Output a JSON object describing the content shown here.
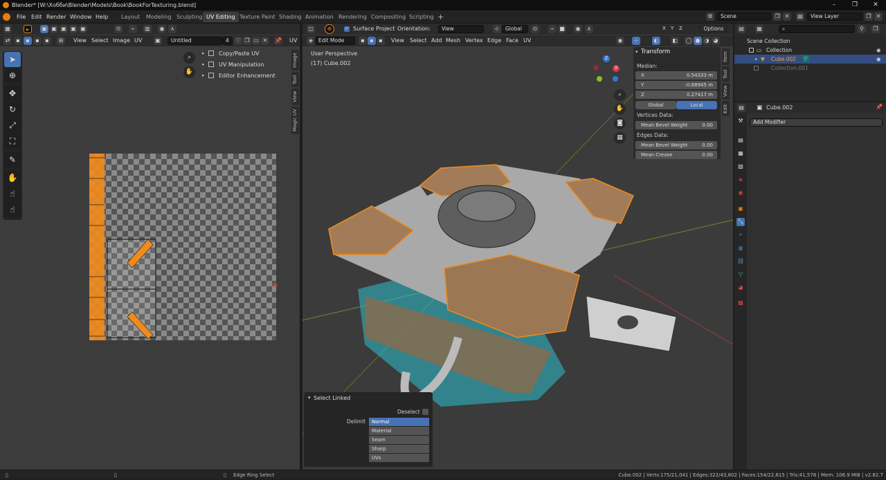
{
  "window": {
    "title": "Blender* [W:\\Хобби\\Blender\\Models\\Book\\BookForTexturing.blend]"
  },
  "menu": [
    "File",
    "Edit",
    "Render",
    "Window",
    "Help"
  ],
  "workspaces": [
    "Layout",
    "Modeling",
    "Sculpting",
    "UV Editing",
    "Texture Paint",
    "Shading",
    "Animation",
    "Rendering",
    "Compositing",
    "Scripting"
  ],
  "active_workspace": "UV Editing",
  "scene": {
    "label": "Scene",
    "view_layer": "View Layer"
  },
  "uv_editor": {
    "menus": [
      "View",
      "Select",
      "Image",
      "UV"
    ],
    "image_name": "Untitled",
    "image_users": "4",
    "right_label": "UV",
    "addon_panels": [
      "Copy/Paste UV",
      "UV Manipulation",
      "Editor Enhancement"
    ],
    "side_tabs": [
      "Image",
      "Tool",
      "View",
      "Magic UV"
    ]
  },
  "viewport": {
    "surface_project_label": "Surface Project",
    "orientation_label": "Orientation:",
    "orientation_value": "View",
    "mode": "Edit Mode",
    "menus": [
      "View",
      "Select",
      "Add",
      "Mesh",
      "Vertex",
      "Edge",
      "Face",
      "UV"
    ],
    "transform_space": "Global",
    "options_label": "Options",
    "overlay_line1": "User Perspective",
    "overlay_line2": "(17) Cube.002",
    "side_tabs": [
      "Item",
      "Tool",
      "View",
      "Edit"
    ],
    "gizmo_labels": [
      "X",
      "Y",
      "Z"
    ]
  },
  "transform_panel": {
    "title": "Transform",
    "median_label": "Median:",
    "coords": [
      {
        "axis": "X",
        "value": "0.54333 m"
      },
      {
        "axis": "Y",
        "value": "-0.68945 m"
      },
      {
        "axis": "Z",
        "value": "0.27417 m"
      }
    ],
    "space_buttons": [
      "Global",
      "Local"
    ],
    "vertices_label": "Vertices Data:",
    "vertex_fields": [
      {
        "label": "Mean Bevel Weight",
        "value": "0.00"
      }
    ],
    "edges_label": "Edges Data:",
    "edge_fields": [
      {
        "label": "Mean Bevel Weight",
        "value": "0.00"
      },
      {
        "label": "Mean Crease",
        "value": "0.00"
      }
    ]
  },
  "select_linked": {
    "title": "Select Linked",
    "deselect_label": "Deselect",
    "delimit_label": "Delimit",
    "options": [
      "Normal",
      "Material",
      "Seam",
      "Sharp",
      "UVs"
    ]
  },
  "outliner": {
    "root": "Scene Collection",
    "items": [
      "Collection",
      "Cube.002",
      "Collection.001"
    ]
  },
  "properties": {
    "object_name": "Cube.002",
    "add_modifier": "Add Modifier"
  },
  "status": {
    "hint": "Edge Ring Select",
    "stats": "Cube.002 | Verts:175/21,041 | Edges:322/43,802 | Faces:154/22,815 | Tris:41,578 | Mem: 106.9 MiB | v2.82.7"
  },
  "colors": {
    "accent": "#4772b3",
    "selection_orange": "#f08a1c",
    "seam_cyan": "#37c7d6"
  }
}
